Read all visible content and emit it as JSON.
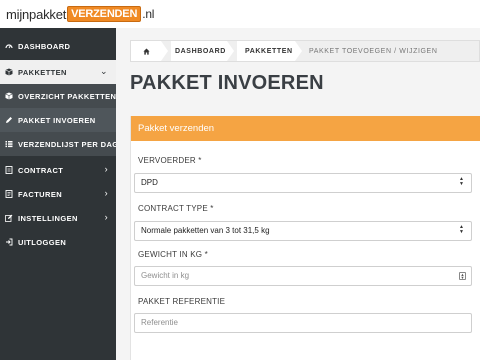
{
  "header": {
    "logo_prefix": "mijnpakket",
    "logo_box": "VERZENDEN",
    "logo_suffix": ".nl"
  },
  "sidebar": {
    "items": [
      {
        "label": "DASHBOARD",
        "icon": "speedometer-icon"
      },
      {
        "label": "PAKKETTEN",
        "icon": "box-icon",
        "expanded": true
      },
      {
        "label": "OVERZICHT PAKKETTEN",
        "icon": "box-open-icon"
      },
      {
        "label": "PAKKET INVOEREN",
        "icon": "pencil-icon"
      },
      {
        "label": "VERZENDLIJST PER DAG",
        "icon": "list-icon"
      },
      {
        "label": "CONTRACT",
        "icon": "document-icon"
      },
      {
        "label": "FACTUREN",
        "icon": "invoice-icon"
      },
      {
        "label": "INSTELLINGEN",
        "icon": "edit-icon"
      },
      {
        "label": "UITLOGGEN",
        "icon": "logout-icon"
      }
    ]
  },
  "breadcrumb": {
    "home_icon": "home-icon",
    "items": [
      "DASHBOARD",
      "PAKKETTEN",
      "PAKKET TOEVOEGEN / WIJZIGEN"
    ]
  },
  "page": {
    "title": "PAKKET INVOEREN"
  },
  "panel": {
    "title": "Pakket verzenden",
    "fields": {
      "carrier_label": "VERVOERDER *",
      "carrier_value": "DPD",
      "contract_label": "CONTRACT TYPE *",
      "contract_value": "Normale pakketten van 3 tot 31,5 kg",
      "weight_label": "GEWICHT IN KG *",
      "weight_placeholder": "Gewicht in kg",
      "reference_label": "PAKKET REFERENTIE",
      "reference_placeholder": "Referentie"
    }
  },
  "colors": {
    "sidebar_bg": "#2f3437",
    "accent_orange": "#f5a443",
    "logo_orange": "#f08a24"
  }
}
